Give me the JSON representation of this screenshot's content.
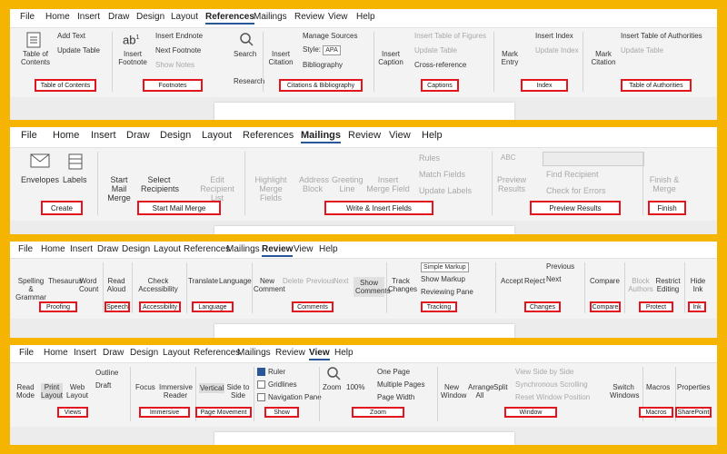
{
  "panels": {
    "references": {
      "tabs": [
        "File",
        "Home",
        "Insert",
        "Draw",
        "Design",
        "Layout",
        "References",
        "Mailings",
        "Review",
        "View",
        "Help"
      ],
      "active_tab": "References",
      "items": {
        "toc": "Table of Contents",
        "add_text": "Add Text",
        "update_table": "Update Table",
        "insert_footnote": "Insert Footnote",
        "insert_endnote": "Insert Endnote",
        "next_footnote": "Next Footnote",
        "show_notes": "Show Notes",
        "search": "Search",
        "research": "Research",
        "insert_citation": "Insert Citation",
        "manage_sources": "Manage Sources",
        "style_label": "Style:",
        "style_value": "APA",
        "bibliography": "Bibliography",
        "insert_caption": "Insert Caption",
        "insert_table_of_figures": "Insert Table of Figures",
        "update_table_captions": "Update Table",
        "cross_reference": "Cross-reference",
        "mark_entry": "Mark Entry",
        "insert_index": "Insert Index",
        "update_index": "Update Index",
        "mark_citation": "Mark Citation",
        "insert_table_of_authorities": "Insert Table of Authorities",
        "update_table_authorities": "Update Table"
      },
      "labels": [
        "Table of Contents",
        "Footnotes",
        "Citations & Bibliography",
        "Captions",
        "Index",
        "Table of Authorities"
      ]
    },
    "mailings": {
      "tabs": [
        "File",
        "Home",
        "Insert",
        "Draw",
        "Design",
        "Layout",
        "References",
        "Mailings",
        "Review",
        "View",
        "Help"
      ],
      "active_tab": "Mailings",
      "items": {
        "envelopes": "Envelopes",
        "labels": "Labels",
        "start_mail_merge": "Start Mail Merge",
        "select_recipients": "Select Recipients",
        "edit_recipient_list": "Edit Recipient List",
        "highlight_merge_fields": "Highlight Merge Fields",
        "address_block": "Address Block",
        "greeting_line": "Greeting Line",
        "insert_merge_field": "Insert Merge Field",
        "rules": "Rules",
        "match_fields": "Match Fields",
        "update_labels": "Update Labels",
        "preview_results": "Preview Results",
        "abc": "ABC",
        "find_recipient": "Find Recipient",
        "check_for_errors": "Check for Errors",
        "finish_merge": "Finish & Merge"
      },
      "labels": [
        "Create",
        "Start Mail Merge",
        "Write & Insert Fields",
        "Preview Results",
        "Finish"
      ]
    },
    "review": {
      "tabs": [
        "File",
        "Home",
        "Insert",
        "Draw",
        "Design",
        "Layout",
        "References",
        "Mailings",
        "Review",
        "View",
        "Help"
      ],
      "active_tab": "Review",
      "items": {
        "spelling": "Spelling & Grammar",
        "thesaurus": "Thesaurus",
        "word_count": "Word Count",
        "read_aloud": "Read Aloud",
        "check_accessibility": "Check Accessibility",
        "translate": "Translate",
        "language": "Language",
        "new_comment": "New Comment",
        "delete": "Delete",
        "previous": "Previous",
        "next": "Next",
        "show_comments": "Show Comments",
        "track_changes": "Track Changes",
        "simple_markup": "Simple Markup",
        "show_markup": "Show Markup",
        "reviewing_pane": "Reviewing Pane",
        "accept": "Accept",
        "reject": "Reject",
        "previous_change": "Previous",
        "next_change": "Next",
        "compare": "Compare",
        "block_authors": "Block Authors",
        "restrict_editing": "Restrict Editing",
        "hide_ink": "Hide Ink"
      },
      "labels": [
        "Proofing",
        "Speech",
        "Accessibility",
        "Language",
        "Comments",
        "Tracking",
        "Changes",
        "Compare",
        "Protect",
        "Ink"
      ]
    },
    "view": {
      "tabs": [
        "File",
        "Home",
        "Insert",
        "Draw",
        "Design",
        "Layout",
        "References",
        "Mailings",
        "Review",
        "View",
        "Help"
      ],
      "active_tab": "View",
      "items": {
        "read_mode": "Read Mode",
        "print_layout": "Print Layout",
        "web_layout": "Web Layout",
        "outline": "Outline",
        "draft": "Draft",
        "focus": "Focus",
        "immersive_reader": "Immersive Reader",
        "vertical": "Vertical",
        "side_to_side": "Side to Side",
        "ruler": "Ruler",
        "gridlines": "Gridlines",
        "navigation_pane": "Navigation Pane",
        "zoom": "Zoom",
        "hundred": "100%",
        "one_page": "One Page",
        "multiple_pages": "Multiple Pages",
        "page_width": "Page Width",
        "new_window": "New Window",
        "arrange_all": "Arrange All",
        "split": "Split",
        "view_side_by_side": "View Side by Side",
        "synchronous_scrolling": "Synchronous Scrolling",
        "reset_window_position": "Reset Window Position",
        "switch_windows": "Switch Windows",
        "macros": "Macros",
        "properties": "Properties"
      },
      "labels": [
        "Views",
        "Immersive",
        "Page Movement",
        "Show",
        "Zoom",
        "Window",
        "Macros",
        "SharePoint"
      ]
    }
  },
  "colors": {
    "background": "#f5b400",
    "highlight": "#e3151d",
    "accent": "#2b5797"
  }
}
